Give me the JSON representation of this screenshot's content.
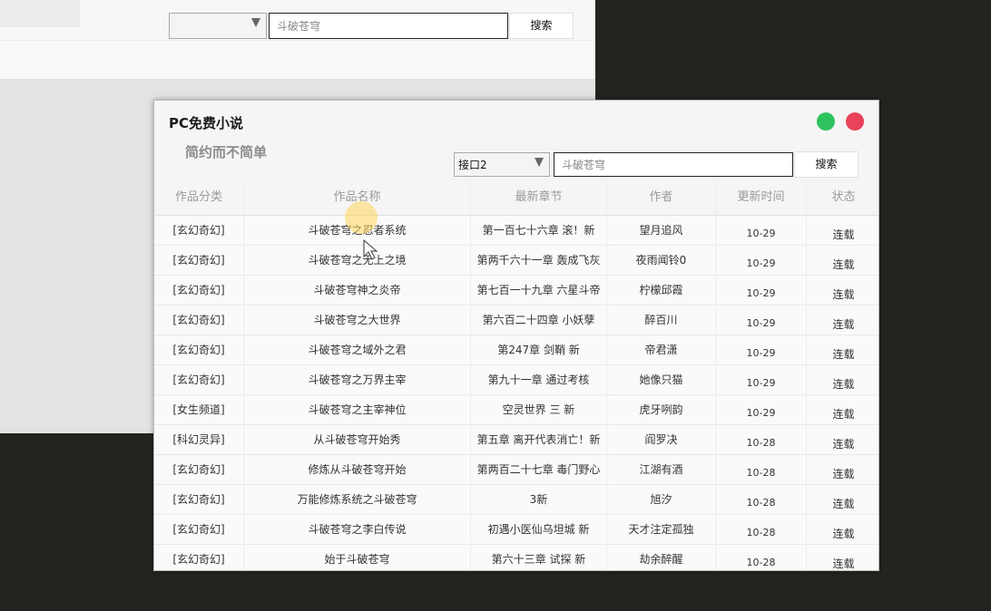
{
  "background_window": {
    "select_value": "",
    "search_value": "斗破苍穹",
    "search_button": "搜索"
  },
  "app": {
    "title": "PC免费小说",
    "subtitle": "简约而不简单",
    "interface_select": "接口2",
    "search_value": "斗破苍穹",
    "search_button": "搜索",
    "window_buttons": {
      "green": "#2fc35f",
      "red": "#e8435a"
    }
  },
  "table": {
    "headers": [
      "作品分类",
      "作品名称",
      "最新章节",
      "作者",
      "更新时间",
      "状态"
    ],
    "rows": [
      {
        "category": "[玄幻奇幻]",
        "name": "斗破苍穹之忍者系统",
        "chapter": "第一百七十六章 滚！新",
        "author": "望月追风",
        "time": "10-29",
        "status": "连载"
      },
      {
        "category": "[玄幻奇幻]",
        "name": "斗破苍穹之无上之境",
        "chapter": "第两千六十一章 轰成飞灰",
        "author": "夜雨闻铃0",
        "time": "10-29",
        "status": "连载"
      },
      {
        "category": "[玄幻奇幻]",
        "name": "斗破苍穹神之炎帝",
        "chapter": "第七百一十九章 六星斗帝",
        "author": "柠檬邱霞",
        "time": "10-29",
        "status": "连载"
      },
      {
        "category": "[玄幻奇幻]",
        "name": "斗破苍穹之大世界",
        "chapter": "第六百二十四章 小妖孽",
        "author": "醉百川",
        "time": "10-29",
        "status": "连载"
      },
      {
        "category": "[玄幻奇幻]",
        "name": "斗破苍穹之域外之君",
        "chapter": "第247章 剑鞘 新",
        "author": "帝君潇",
        "time": "10-29",
        "status": "连载"
      },
      {
        "category": "[玄幻奇幻]",
        "name": "斗破苍穹之万界主宰",
        "chapter": "第九十一章 通过考核",
        "author": "她像只猫",
        "time": "10-29",
        "status": "连载"
      },
      {
        "category": "[女生频道]",
        "name": "斗破苍穹之主宰神位",
        "chapter": "空灵世界 三 新",
        "author": "虎牙咧韵",
        "time": "10-29",
        "status": "连载"
      },
      {
        "category": "[科幻灵异]",
        "name": "从斗破苍穹开始秀",
        "chapter": "第五章 离开代表消亡！新",
        "author": "阎罗决",
        "time": "10-28",
        "status": "连载"
      },
      {
        "category": "[玄幻奇幻]",
        "name": "修炼从斗破苍穹开始",
        "chapter": "第两百二十七章 毒门野心",
        "author": "江湖有酒",
        "time": "10-28",
        "status": "连载"
      },
      {
        "category": "[玄幻奇幻]",
        "name": "万能修炼系统之斗破苍穹",
        "chapter": "3新",
        "author": "旭汐",
        "time": "10-28",
        "status": "连载"
      },
      {
        "category": "[玄幻奇幻]",
        "name": "斗破苍穹之李白传说",
        "chapter": "初遇小医仙乌坦城 新",
        "author": "天才注定孤独",
        "time": "10-28",
        "status": "连载"
      },
      {
        "category": "[玄幻奇幻]",
        "name": "始于斗破苍穹",
        "chapter": "第六十三章 试探 新",
        "author": "劫余醉醒",
        "time": "10-28",
        "status": "连载"
      }
    ]
  }
}
